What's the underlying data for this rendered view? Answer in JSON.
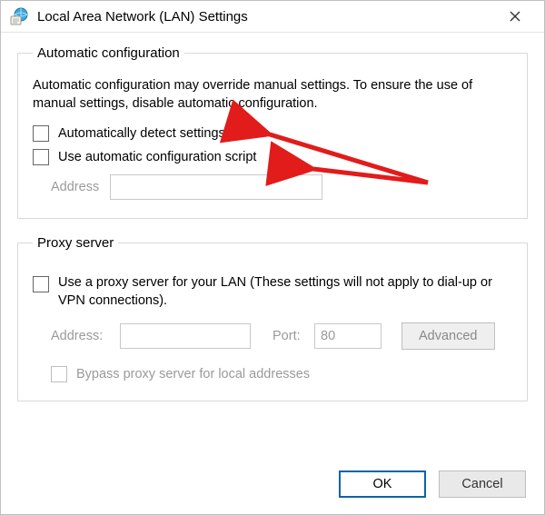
{
  "window": {
    "title": "Local Area Network (LAN) Settings"
  },
  "auto": {
    "legend": "Automatic configuration",
    "description": "Automatic configuration may override manual settings.  To ensure the use of manual settings, disable automatic configuration.",
    "detect_label": "Automatically detect settings",
    "script_label": "Use automatic configuration script",
    "address_label": "Address",
    "address_value": ""
  },
  "proxy": {
    "legend": "Proxy server",
    "use_label": "Use a proxy server for your LAN (These settings will not apply to dial-up or VPN connections).",
    "address_label": "Address:",
    "address_value": "",
    "port_label": "Port:",
    "port_value": "80",
    "advanced_label": "Advanced",
    "bypass_label": "Bypass proxy server for local addresses"
  },
  "buttons": {
    "ok": "OK",
    "cancel": "Cancel"
  }
}
